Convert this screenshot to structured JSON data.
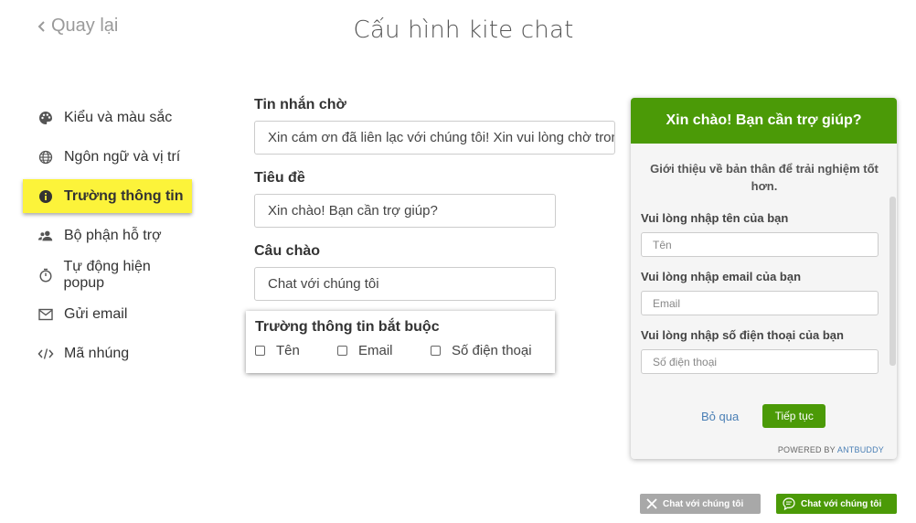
{
  "nav": {
    "back_label": "Quay lại"
  },
  "page": {
    "title": "Cấu hình kite chat"
  },
  "sidebar": {
    "items": [
      {
        "label": "Kiểu và màu sắc",
        "icon": "palette-icon"
      },
      {
        "label": "Ngôn ngữ và vị trí",
        "icon": "globe-icon"
      },
      {
        "label": "Trường thông tin",
        "icon": "info-icon",
        "active": true
      },
      {
        "label": "Bộ phận hỗ trợ",
        "icon": "user-group-icon"
      },
      {
        "label": "Tự động hiện popup",
        "icon": "timer-icon"
      },
      {
        "label": "Gửi email",
        "icon": "mail-icon"
      },
      {
        "label": "Mã nhúng",
        "icon": "code-icon"
      }
    ],
    "active_color": "#fcf33a"
  },
  "form": {
    "waiting_message": {
      "label": "Tin nhắn chờ",
      "value": "Xin cám ơn đã liên lạc với chúng tôi! Xin vui lòng chờ trong giây lát"
    },
    "title": {
      "label": "Tiêu đề",
      "value": "Xin chào! Bạn cần trợ giúp?"
    },
    "greeting": {
      "label": "Câu chào",
      "value": "Chat với chúng tôi"
    },
    "required_fields": {
      "label": "Trường thông tin bắt buộc",
      "options": [
        "Tên",
        "Email",
        "Số điện thoại"
      ]
    }
  },
  "widget": {
    "header": "Xin chào! Bạn cần trợ giúp?",
    "intro": "Giới thiệu về bản thân để trải nghiệm tốt hơn.",
    "name_label": "Vui lòng nhập tên của bạn",
    "name_placeholder": "Tên",
    "email_label": "Vui lòng nhập email của bạn",
    "email_placeholder": "Email",
    "phone_label": "Vui lòng nhập số điện thoại của bạn",
    "phone_placeholder": "Số điện thoại",
    "skip_label": "Bỏ qua",
    "continue_label": "Tiếp tục",
    "powered_prefix": "POWERED BY",
    "powered_brand": "ANTBUDDY",
    "brand_color": "#4b9a07"
  },
  "chat_buttons": {
    "close_label": "Chat với chúng tôi",
    "open_label": "Chat với chúng tôi"
  }
}
